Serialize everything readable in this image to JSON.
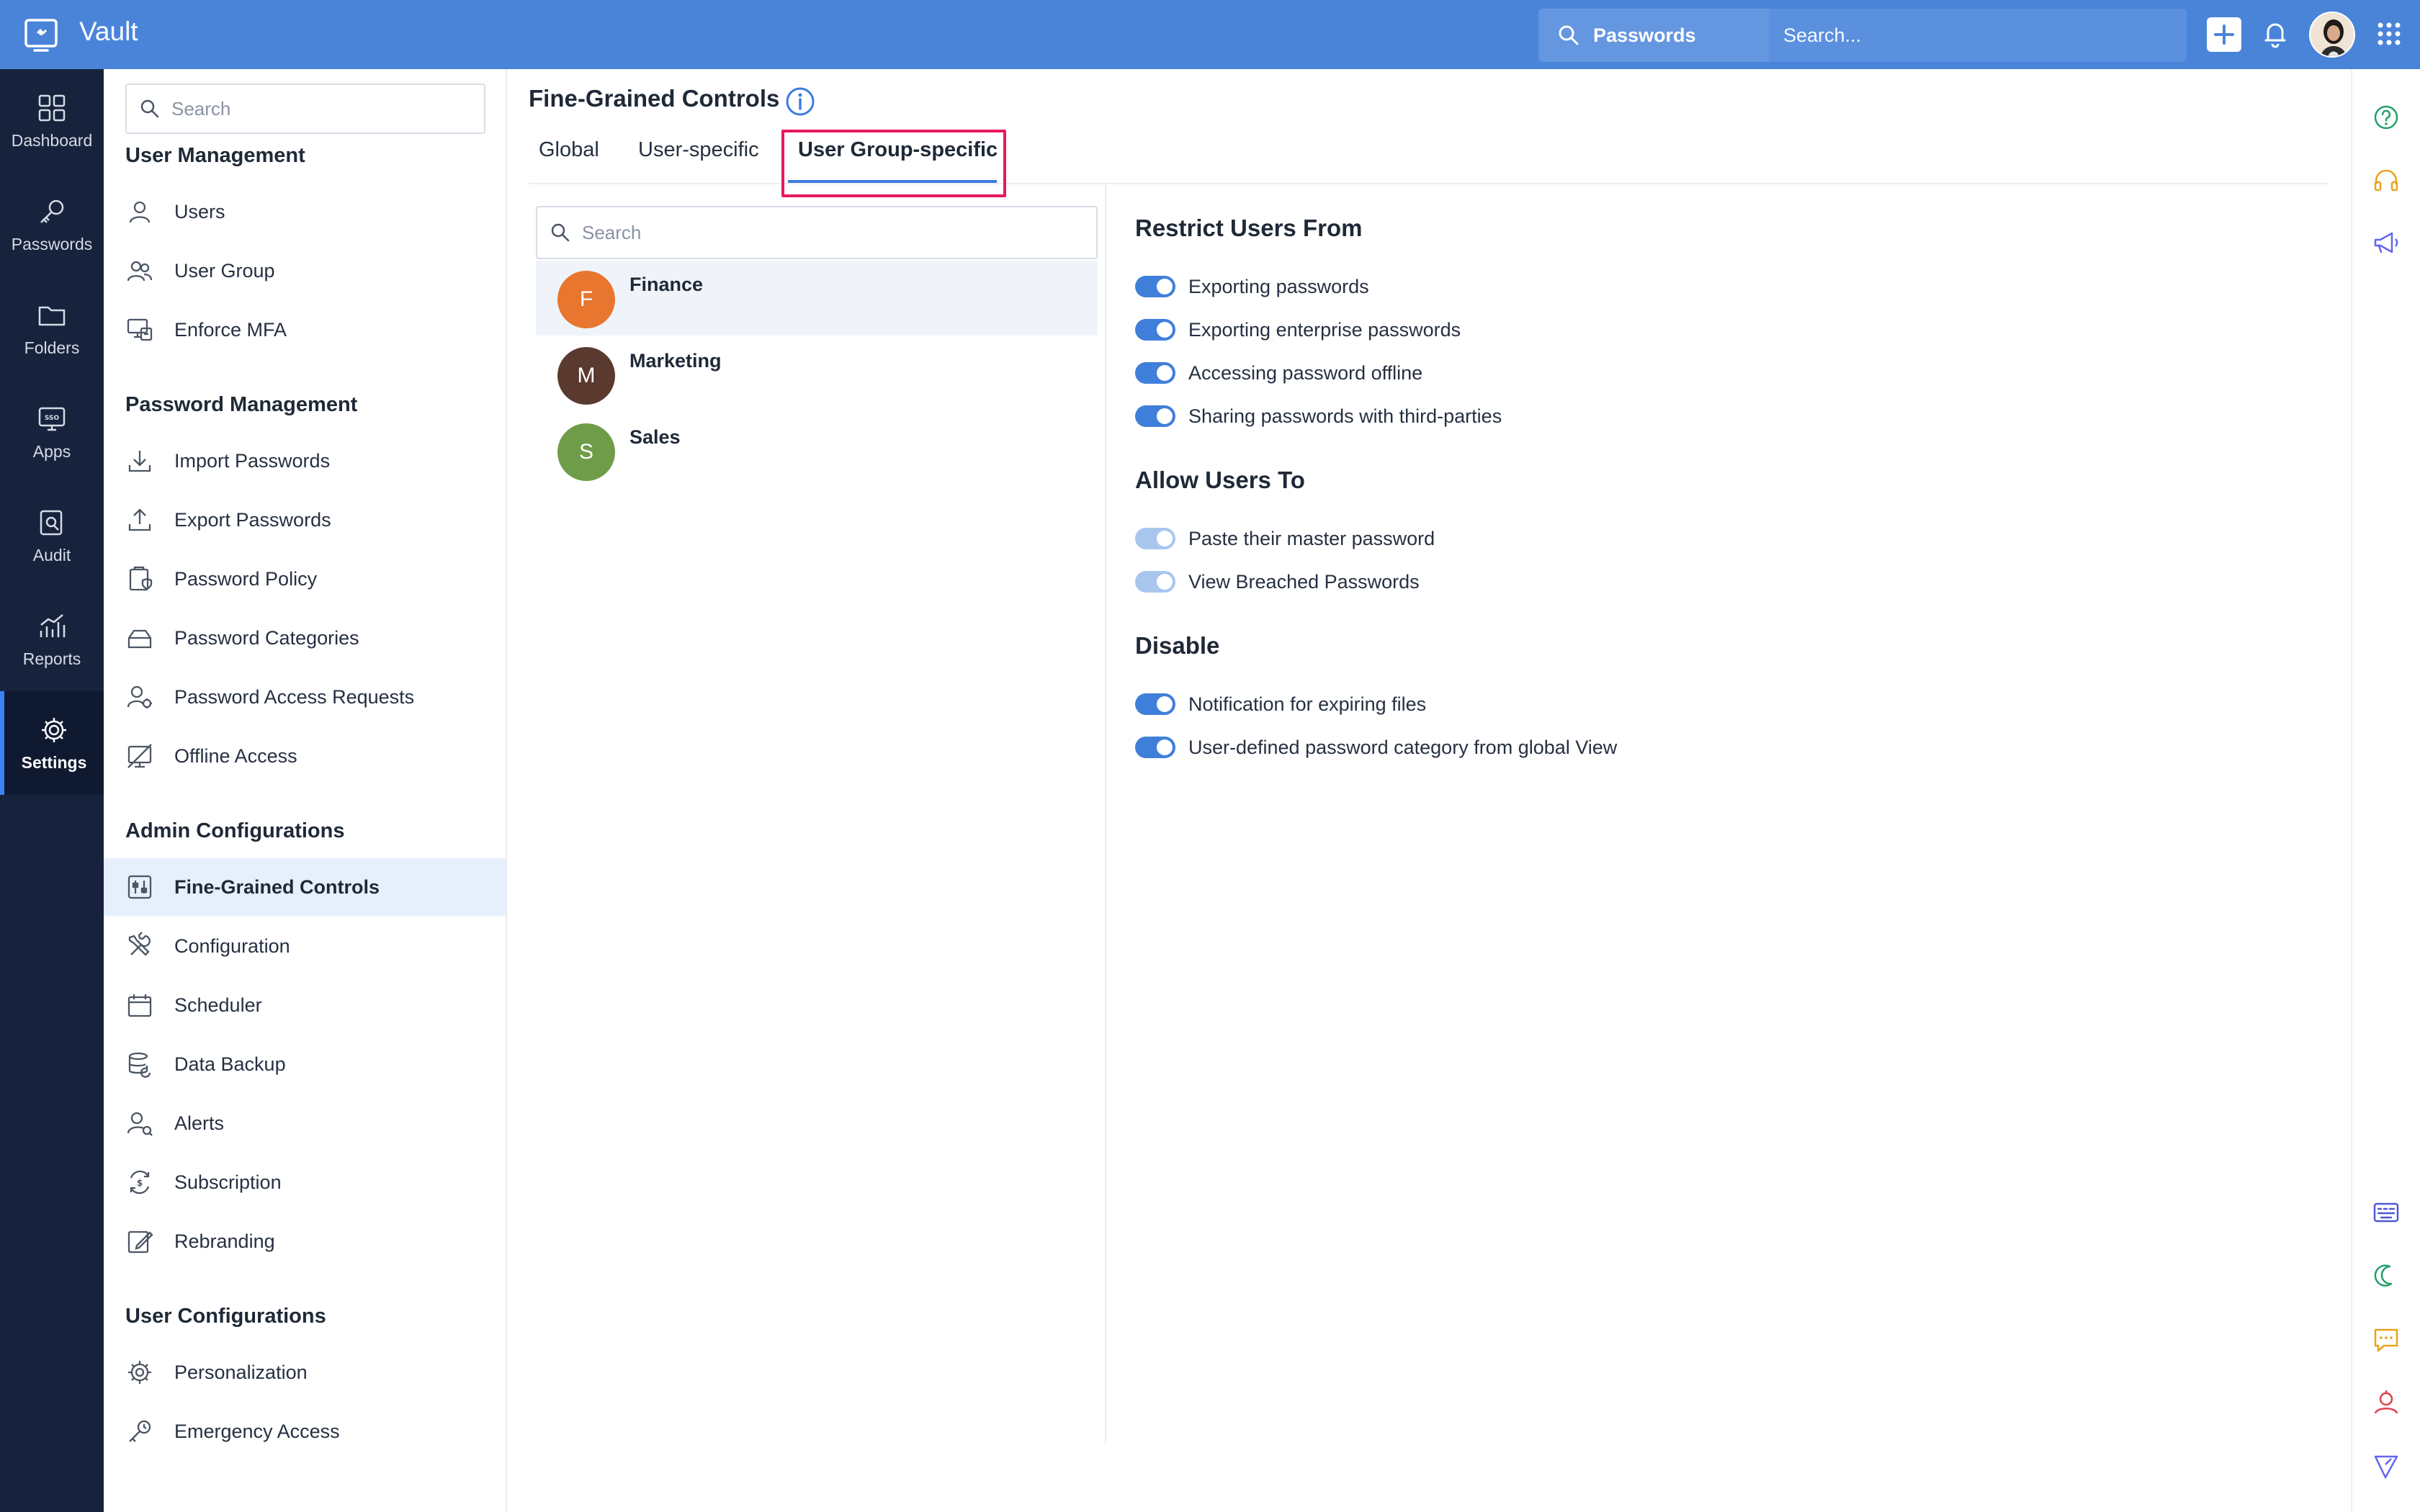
{
  "app": {
    "title": "Vault"
  },
  "topbar": {
    "search_scope": "Passwords",
    "search_placeholder": "Search..."
  },
  "nav": {
    "items": [
      {
        "label": "Dashboard",
        "icon": "dashboard-icon"
      },
      {
        "label": "Passwords",
        "icon": "key-icon"
      },
      {
        "label": "Folders",
        "icon": "folder-icon"
      },
      {
        "label": "Apps",
        "icon": "sso-icon"
      },
      {
        "label": "Audit",
        "icon": "audit-icon"
      },
      {
        "label": "Reports",
        "icon": "reports-icon"
      },
      {
        "label": "Settings",
        "icon": "gear-icon",
        "active": true
      }
    ]
  },
  "sidebar": {
    "search_placeholder": "Search",
    "sections": [
      {
        "title": "User Management",
        "items": [
          "Users",
          "User Group",
          "Enforce MFA"
        ]
      },
      {
        "title": "Password Management",
        "items": [
          "Import Passwords",
          "Export Passwords",
          "Password Policy",
          "Password Categories",
          "Password Access Requests",
          "Offline Access"
        ]
      },
      {
        "title": "Admin Configurations",
        "items": [
          "Fine-Grained Controls",
          "Configuration",
          "Scheduler",
          "Data Backup",
          "Alerts",
          "Subscription",
          "Rebranding"
        ]
      },
      {
        "title": "User Configurations",
        "items": [
          "Personalization",
          "Emergency Access"
        ]
      }
    ],
    "active_item": "Fine-Grained Controls"
  },
  "main": {
    "title": "Fine-Grained Controls",
    "tabs": [
      "Global",
      "User-specific",
      "User Group-specific"
    ],
    "active_tab": "User Group-specific",
    "group_search_placeholder": "Search",
    "groups": [
      {
        "initial": "F",
        "name": "Finance",
        "color": "#e8762e",
        "selected": true
      },
      {
        "initial": "M",
        "name": "Marketing",
        "color": "#5a3a2e"
      },
      {
        "initial": "S",
        "name": "Sales",
        "color": "#6e9c48"
      }
    ],
    "controls": {
      "restrict": {
        "title": "Restrict Users From",
        "items": [
          "Exporting passwords",
          "Exporting enterprise passwords",
          "Accessing password offline",
          "Sharing passwords with third-parties"
        ]
      },
      "allow": {
        "title": "Allow Users To",
        "items": [
          "Paste their master password",
          "View Breached Passwords"
        ]
      },
      "disable": {
        "title": "Disable",
        "items": [
          "Notification for expiring files",
          "User-defined password category from global View"
        ]
      }
    }
  },
  "colors": {
    "topbar": "#4a84d9",
    "rail": "#17233d",
    "accent": "#3f7fd9",
    "highlight": "#e8195a"
  }
}
